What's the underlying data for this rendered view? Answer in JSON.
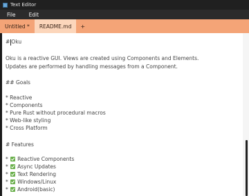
{
  "window": {
    "title": "Text Editor"
  },
  "menu": [
    "File",
    "Edit"
  ],
  "tabs": [
    {
      "label": "Untitled *",
      "active": false
    },
    {
      "label": "README.md",
      "active": true
    }
  ],
  "add_tab_label": "+",
  "editor": {
    "heading_prefix": "#",
    "heading_text": "Oku",
    "intro_1": "Oku is a reactive GUI. Views are created using Components and Elements.",
    "intro_2": "Updates are performed by handling messages from a Component.",
    "goals_heading": "## Goals",
    "goals": [
      "* Reactive",
      "* Components",
      "* Pure Rust without procedural macros",
      "* Web-like styling",
      "* Cross Platform"
    ],
    "features_heading": "# Features",
    "feature_bullet": "*",
    "features": [
      "Reactive Components",
      "Async Updates",
      "Text Rendering",
      "Windows/Linux",
      "Android(basic)"
    ]
  },
  "colors": {
    "tabbar": "#f4a477",
    "active_tab": "#fcd6bb",
    "checkbox": "#6bb04d",
    "titlebar": "#202020"
  },
  "icons": {
    "app": "app-icon",
    "check": "checkbox-checked-icon"
  }
}
